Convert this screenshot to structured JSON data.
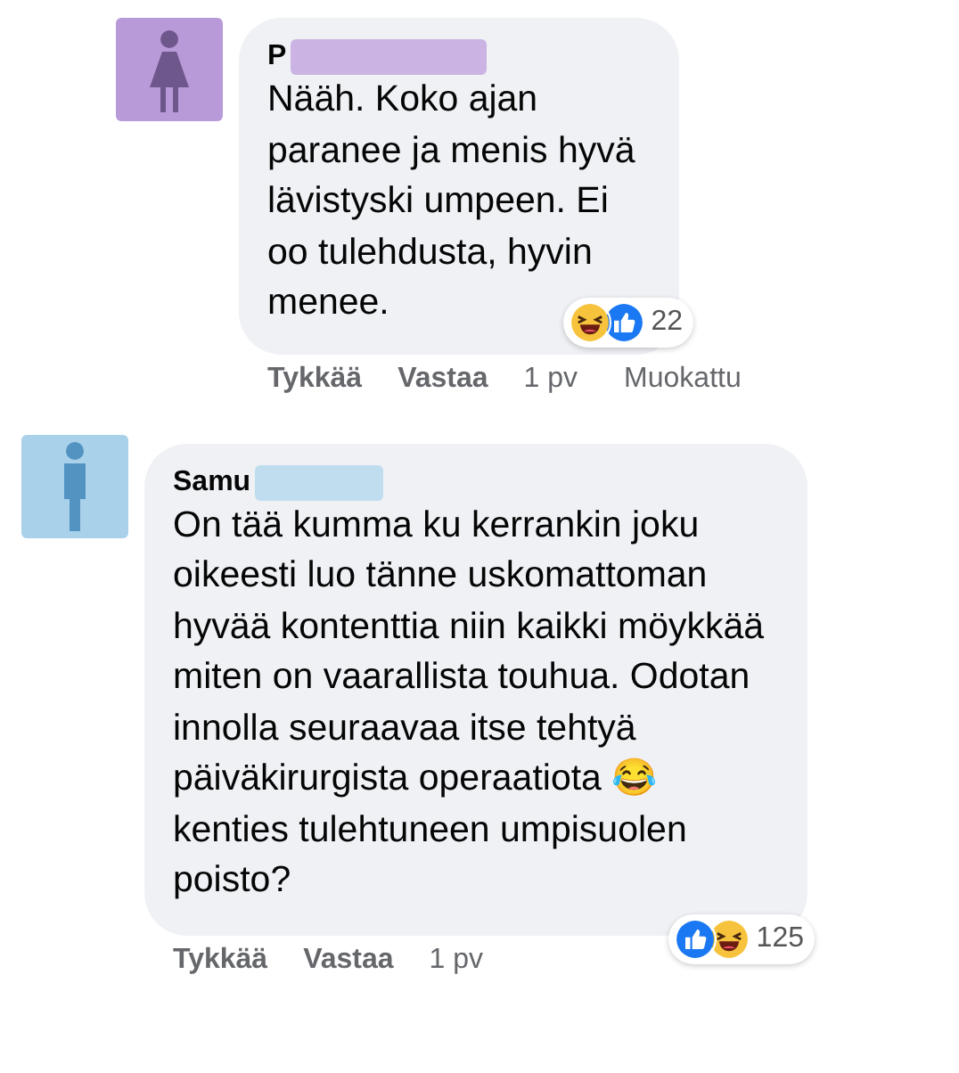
{
  "comments": [
    {
      "kind": "reply",
      "avatar": {
        "kind": "female",
        "color": "#b99ad9"
      },
      "author": "P",
      "text": "Nääh. Koko ajan paranee ja menis hyvä lävistyski umpeen. Ei oo tulehdusta, hyvin menee.",
      "reactions": {
        "icons": [
          {
            "kind": "haha"
          },
          {
            "kind": "like"
          }
        ],
        "count": "22"
      },
      "actions": [
        "Tykkää",
        "Vastaa"
      ],
      "time": "1 pv",
      "edited": "Muokattu"
    },
    {
      "kind": "comment",
      "avatar": {
        "kind": "male",
        "color": "#a9d1ea"
      },
      "author": "Samu",
      "text": "On tää kumma ku kerrankin joku oikeesti luo tänne uskomattoman hyvää kontenttia niin kaikki möykkää miten on vaarallista touhua. Odotan innolla seuraavaa itse tehtyä päiväkirurgista operaatiota 😂 kenties tulehtuneen umpisuolen poisto?",
      "reactions": {
        "icons": [
          {
            "kind": "like"
          },
          {
            "kind": "haha"
          }
        ],
        "count": "125"
      },
      "actions": [
        "Tykkää",
        "Vastaa"
      ],
      "time": "1 pv"
    }
  ]
}
